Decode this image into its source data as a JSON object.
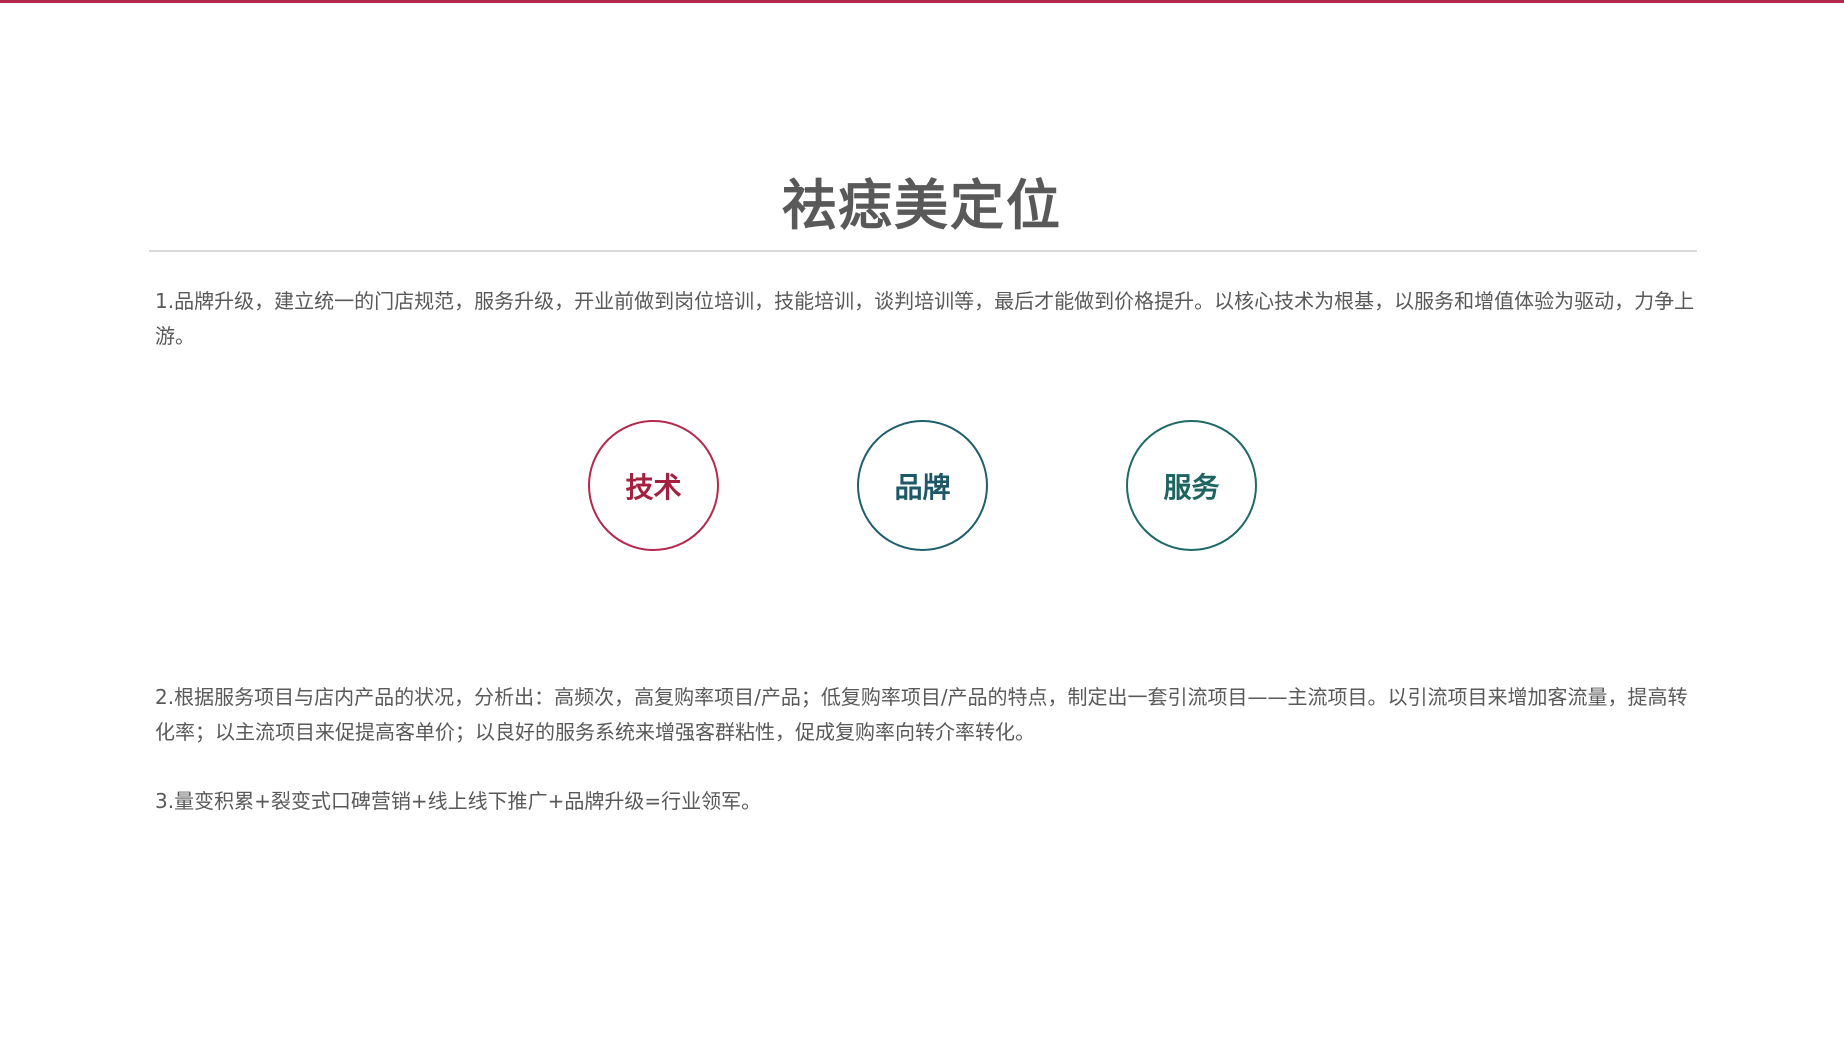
{
  "title": "祛痣美定位",
  "paragraphs": {
    "p1": "1.品牌升级，建立统一的门店规范，服务升级，开业前做到岗位培训，技能培训，谈判培训等，最后才能做到价格提升。以核心技术为根基，以服务和增值体验为驱动，力争上游。",
    "p2": "2.根据服务项目与店内产品的状况，分析出：高频次，高复购率项目/产品；低复购率项目/产品的特点，制定出一套引流项目——主流项目。以引流项目来增加客流量，提高转化率；以主流项目来促提高客单价；以良好的服务系统来增强客群粘性，促成复购率向转介率转化。",
    "p3": "3.量变积累+裂变式口碑营销+线上线下推广+品牌升级=行业领军。"
  },
  "circles": [
    {
      "label": "技术",
      "color": "#b5294e"
    },
    {
      "label": "品牌",
      "color": "#1f5f6e"
    },
    {
      "label": "服务",
      "color": "#1f6a66"
    }
  ],
  "colors": {
    "accent_bar": "#b5294e",
    "text": "#595959",
    "divider": "#d9d9d9"
  }
}
